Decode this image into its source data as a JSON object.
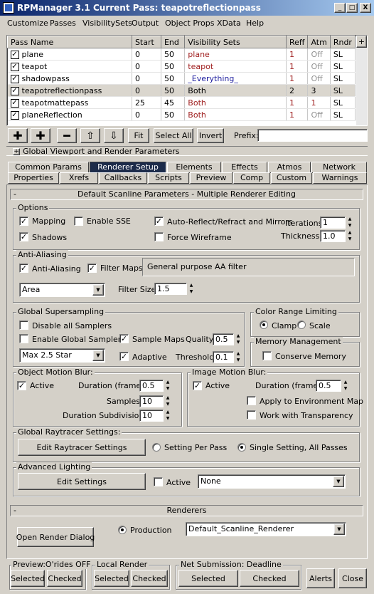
{
  "window": {
    "title": "RPManager 3.1   Current Pass: teapotreflectionpass",
    "controls": [
      "_",
      "□",
      "X"
    ]
  },
  "menu": [
    "Customize",
    "Passes",
    "VisibilitySets",
    "Output",
    "Object Props",
    "XData",
    "Help"
  ],
  "passes": {
    "columns": [
      "Pass Name",
      "Start",
      "End",
      "Visibility Sets",
      "Reff",
      "Atm",
      "Rndr"
    ],
    "rows": [
      {
        "name": "plane",
        "start": "0",
        "end": "50",
        "vis": "plane",
        "reff": "1",
        "atm": "Off",
        "rndr": "SL",
        "vis_color": "#a02020",
        "reff_color": "#a02020",
        "atm_color": "#909090"
      },
      {
        "name": "teapot",
        "start": "0",
        "end": "50",
        "vis": "teapot",
        "reff": "1",
        "atm": "Off",
        "rndr": "SL",
        "vis_color": "#a02020",
        "reff_color": "#a02020",
        "atm_color": "#909090"
      },
      {
        "name": "shadowpass",
        "start": "0",
        "end": "50",
        "vis": "_Everything_",
        "reff": "1",
        "atm": "Off",
        "rndr": "SL",
        "vis_color": "#2020a0",
        "reff_color": "#a02020",
        "atm_color": "#909090"
      },
      {
        "name": "teapotreflectionpass",
        "start": "0",
        "end": "50",
        "vis": "Both",
        "reff": "2",
        "atm": "3",
        "rndr": "SL",
        "vis_color": "#000000",
        "reff_color": "#000000",
        "atm_color": "#000000"
      },
      {
        "name": "teapotmattepass",
        "start": "25",
        "end": "45",
        "vis": "Both",
        "reff": "1",
        "atm": "1",
        "rndr": "SL",
        "vis_color": "#a02020",
        "reff_color": "#a02020",
        "atm_color": "#a02020"
      },
      {
        "name": "planeReflection",
        "start": "0",
        "end": "50",
        "vis": "Both",
        "reff": "1",
        "atm": "Off",
        "rndr": "SL",
        "vis_color": "#a02020",
        "reff_color": "#a02020",
        "atm_color": "#909090"
      }
    ],
    "scroll_plus": "+"
  },
  "toolbar": {
    "fit": "Fit",
    "select_all": "Select All",
    "invert": "Invert",
    "prefix_label": "Prefix:",
    "prefix_value": ""
  },
  "global_viewport": {
    "toggle": "+",
    "label": "Global Viewport and Render Parameters"
  },
  "tabs_row1": [
    "Common Params",
    "Renderer Setup",
    "Elements",
    "Effects",
    "Atmos",
    "Network"
  ],
  "tabs_row2": [
    "Properties",
    "Xrefs",
    "Callbacks",
    "Scripts",
    "Preview",
    "Comp",
    "Custom",
    "Warnings"
  ],
  "scanline": {
    "toggle": "-",
    "header": "Default Scanline Parameters - Multiple Renderer Editing",
    "options": {
      "title": "Options",
      "mapping": "Mapping",
      "enable_sse": "Enable SSE",
      "auto_reflect": "Auto-Reflect/Refract and Mirrors",
      "shadows": "Shadows",
      "force_wireframe": "Force Wireframe",
      "iterations_label": "Iterations:",
      "iterations": "1",
      "thickness_label": "Thickness:",
      "thickness": "1.0"
    },
    "aa": {
      "title": "Anti-Aliasing",
      "anti_aliasing": "Anti-Aliasing",
      "filter_maps": "Filter Maps",
      "filter_desc": "General purpose AA filter",
      "filter": "Area",
      "filter_size_label": "Filter Size:",
      "filter_size": "1.5"
    },
    "gss": {
      "title": "Global Supersampling",
      "disable_all": "Disable all Samplers",
      "enable_global": "Enable Global Sampler",
      "sample_maps": "Sample Maps",
      "adaptive": "Adaptive",
      "quality_label": "Quality:",
      "quality": "0.5",
      "threshold_label": "Threshold:",
      "threshold": "0.1",
      "sampler": "Max 2.5 Star"
    },
    "crl": {
      "title": "Color Range Limiting",
      "clamp": "Clamp",
      "scale": "Scale"
    },
    "mem": {
      "title": "Memory Management",
      "conserve": "Conserve Memory"
    },
    "omb": {
      "title": "Object Motion Blur:",
      "active": "Active",
      "duration_label": "Duration (frames):",
      "duration": "0.5",
      "samples_label": "Samples:",
      "samples": "10",
      "subdiv_label": "Duration Subdivisions:",
      "subdiv": "10"
    },
    "imb": {
      "title": "Image Motion Blur:",
      "active": "Active",
      "duration_label": "Duration (frames):",
      "duration": "0.5",
      "apply_env": "Apply to Environment Map",
      "work_transp": "Work with Transparency"
    },
    "raytracer": {
      "title": "Global Raytracer Settings:",
      "edit": "Edit Raytracer Settings",
      "per_pass": "Setting Per Pass",
      "single": "Single Setting, All Passes"
    },
    "adv": {
      "title": "Advanced Lighting",
      "edit": "Edit Settings",
      "active": "Active",
      "value": "None"
    }
  },
  "renderers": {
    "toggle": "-",
    "header": "Renderers",
    "open_dialog": "Open Render Dialog",
    "production": "Production",
    "renderer": "Default_Scanline_Renderer"
  },
  "bottom": {
    "preview": {
      "title": "Preview:O'rides OFF",
      "selected": "Selected",
      "checked": "Checked"
    },
    "local": {
      "title": "Local Render",
      "selected": "Selected",
      "checked": "Checked"
    },
    "net": {
      "title": "Net Submission: Deadline",
      "selected": "Selected",
      "checked": "Checked"
    },
    "alerts": "Alerts",
    "close": "Close"
  }
}
